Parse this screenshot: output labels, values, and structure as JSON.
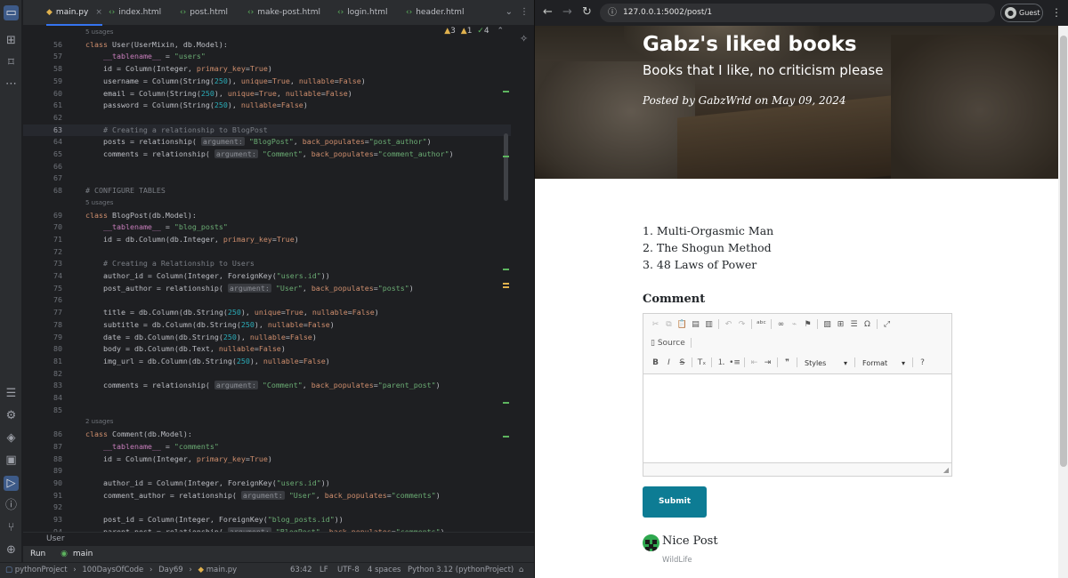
{
  "ide": {
    "tabs": [
      {
        "label": "main.py",
        "icon": "python-file-icon"
      },
      {
        "label": "index.html",
        "icon": "html-file-icon"
      },
      {
        "label": "post.html",
        "icon": "html-file-icon"
      },
      {
        "label": "make-post.html",
        "icon": "html-file-icon"
      },
      {
        "label": "login.html",
        "icon": "html-file-icon"
      },
      {
        "label": "header.html",
        "icon": "html-file-icon"
      }
    ],
    "close_glyph": "×",
    "more_glyph": "⌄",
    "menu_glyph": "⋮",
    "inspections": {
      "warnings": "3",
      "weak_warnings": "1",
      "ok": "4"
    },
    "code_lines": [
      {
        "n": "",
        "hint": true,
        "text": "5 usages"
      },
      {
        "n": "56",
        "text": "class User(UserMixin, db.Model):"
      },
      {
        "n": "57",
        "text": "    __tablename__ = \"users\""
      },
      {
        "n": "58",
        "text": "    id = Column(Integer, primary_key=True)"
      },
      {
        "n": "59",
        "text": "    username = Column(String(250), unique=True, nullable=False)"
      },
      {
        "n": "60",
        "text": "    email = Column(String(250), unique=True, nullable=False)"
      },
      {
        "n": "61",
        "text": "    password = Column(String(250), nullable=False)"
      },
      {
        "n": "62",
        "text": ""
      },
      {
        "n": "63",
        "text": "    # Creating a relationship to BlogPost",
        "cur": true
      },
      {
        "n": "64",
        "text": "    posts = relationship( argument: \"BlogPost\", back_populates=\"post_author\")"
      },
      {
        "n": "65",
        "text": "    comments = relationship( argument: \"Comment\", back_populates=\"comment_author\")"
      },
      {
        "n": "66",
        "text": ""
      },
      {
        "n": "67",
        "text": ""
      },
      {
        "n": "68",
        "text": "# CONFIGURE TABLES"
      },
      {
        "n": "",
        "hint": true,
        "text": "5 usages"
      },
      {
        "n": "69",
        "text": "class BlogPost(db.Model):"
      },
      {
        "n": "70",
        "text": "    __tablename__ = \"blog_posts\""
      },
      {
        "n": "71",
        "text": "    id = db.Column(db.Integer, primary_key=True)"
      },
      {
        "n": "72",
        "text": ""
      },
      {
        "n": "73",
        "text": "    # Creating a Relationship to Users"
      },
      {
        "n": "74",
        "text": "    author_id = Column(Integer, ForeignKey(\"users.id\"))"
      },
      {
        "n": "75",
        "text": "    post_author = relationship( argument: \"User\", back_populates=\"posts\")"
      },
      {
        "n": "76",
        "text": ""
      },
      {
        "n": "77",
        "text": "    title = db.Column(db.String(250), unique=True, nullable=False)"
      },
      {
        "n": "78",
        "text": "    subtitle = db.Column(db.String(250), nullable=False)"
      },
      {
        "n": "79",
        "text": "    date = db.Column(db.String(250), nullable=False)"
      },
      {
        "n": "80",
        "text": "    body = db.Column(db.Text, nullable=False)"
      },
      {
        "n": "81",
        "text": "    img_url = db.Column(db.String(250), nullable=False)"
      },
      {
        "n": "82",
        "text": ""
      },
      {
        "n": "83",
        "text": "    comments = relationship( argument: \"Comment\", back_populates=\"parent_post\")"
      },
      {
        "n": "84",
        "text": ""
      },
      {
        "n": "85",
        "text": ""
      },
      {
        "n": "",
        "hint": true,
        "text": "2 usages"
      },
      {
        "n": "86",
        "text": "class Comment(db.Model):"
      },
      {
        "n": "87",
        "text": "    __tablename__ = \"comments\""
      },
      {
        "n": "88",
        "text": "    id = Column(Integer, primary_key=True)"
      },
      {
        "n": "89",
        "text": ""
      },
      {
        "n": "90",
        "text": "    author_id = Column(Integer, ForeignKey(\"users.id\"))"
      },
      {
        "n": "91",
        "text": "    comment_author = relationship( argument: \"User\", back_populates=\"comments\")"
      },
      {
        "n": "92",
        "text": ""
      },
      {
        "n": "93",
        "text": "    post_id = Column(Integer, ForeignKey(\"blog_posts.id\"))"
      },
      {
        "n": "94",
        "text": "    parent_post = relationship( argument: \"BlogPost\", back_populates=\"comments\")"
      }
    ],
    "code_breadcrumb": "User",
    "run": {
      "label": "Run",
      "config": "main"
    },
    "status": {
      "path": [
        "pythonProject",
        "100DaysOfCode",
        "Day69",
        "main.py"
      ],
      "path_sep": "›",
      "position": "63:42",
      "line_sep": "LF",
      "encoding": "UTF-8",
      "indent": "4 spaces",
      "interpreter": "Python 3.12 (pythonProject)"
    },
    "colors": {
      "keyword": "#cf8e6d",
      "string": "#6aab73",
      "comment": "#7a7e85",
      "number": "#2aacb8",
      "param": "#c77dbb"
    }
  },
  "browser": {
    "url": "127.0.0.1:5002/post/1",
    "profile": "Guest",
    "post": {
      "title": "Gabz's liked books",
      "subtitle": "Books that I like, no criticism please",
      "meta": "Posted by GabzWrld on May 09, 2024"
    },
    "books": [
      "1. Multi-Orgasmic Man",
      "2. The Shogun Method",
      "3. 48 Laws of Power"
    ],
    "comment_label": "Comment",
    "editor": {
      "source_label": "Source",
      "styles_label": "Styles",
      "format_label": "Format"
    },
    "submit_label": "Submit",
    "comment": {
      "text": "Nice Post",
      "author": "WildLife"
    },
    "accent_color": "#0d7c94"
  }
}
